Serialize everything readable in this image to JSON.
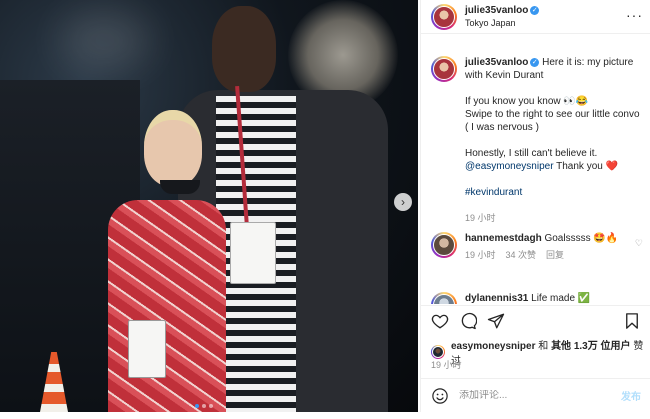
{
  "post": {
    "username": "julie35vanloo",
    "location": "Tokyo Japan",
    "more_icon": "more-icon",
    "caption": {
      "intro": "Here it is: my picture with Kevin Durant",
      "line2a": "If you know you know 👀😂",
      "line2b": "Swipe to the right to see our little convo ( I was nervous )",
      "line3a": "Honestly, I still can't believe it.",
      "mention": "@easymoneysniper",
      "line3b": " Thank you ❤️",
      "hashtag": "#kevindurant",
      "time": "19 小时"
    }
  },
  "comments": [
    {
      "username": "hannemestdagh",
      "text": "Goalsssss 🤩🔥",
      "time": "19 小时",
      "likes": "34 次赞",
      "reply": "回复"
    },
    {
      "username": "dylanennis31",
      "text": "Life made ✅"
    }
  ],
  "actions": {
    "like_icon": "heart-icon",
    "comment_icon": "comment-icon",
    "share_icon": "share-icon",
    "save_icon": "bookmark-icon"
  },
  "likes": {
    "username": "easymoneysniper",
    "connector": " 和 ",
    "others": "其他 1.3万 位用户",
    "suffix": "赞过"
  },
  "post_time": "19 小时",
  "comment_input": {
    "placeholder": "添加评论...",
    "post_label": "发布"
  },
  "carousel": {
    "next_glyph": "›",
    "slide_count": 3,
    "active_slide": 1
  },
  "colors": {
    "link": "#00376b",
    "verified": "#3897f0",
    "post_button_disabled": "#b2dffc",
    "muted": "#8e8e8e"
  }
}
